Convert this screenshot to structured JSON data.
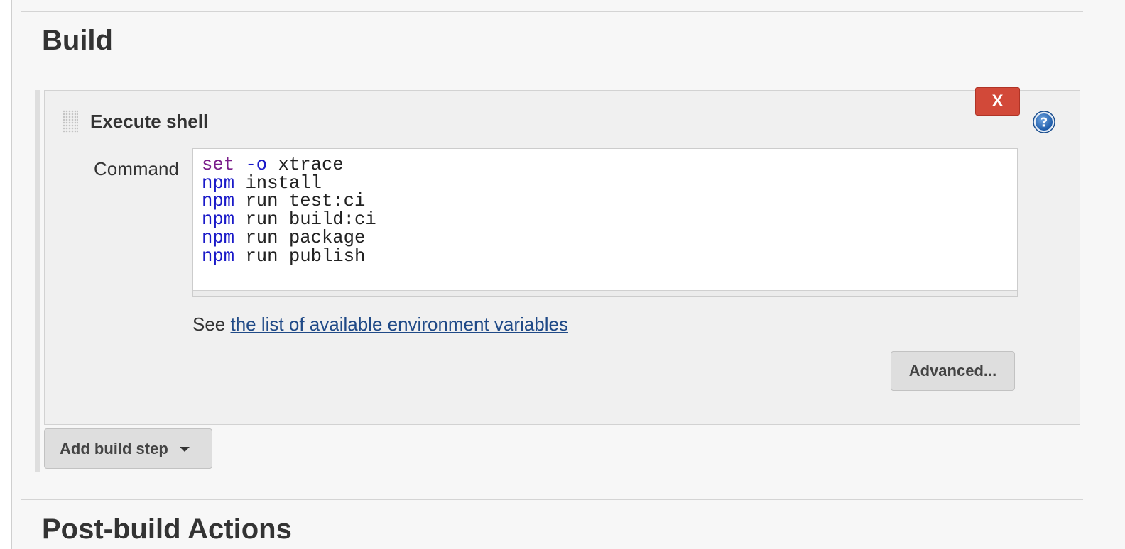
{
  "sections": {
    "build_title": "Build",
    "post_build_title": "Post-build Actions"
  },
  "step": {
    "title": "Execute shell",
    "delete_label": "X",
    "help_icon": "help-circle-icon",
    "command_label": "Command",
    "command_lines": [
      {
        "keyword": "set",
        "flag": "-o",
        "rest": "xtrace"
      },
      {
        "keyword": "",
        "flag": "npm",
        "rest": "install"
      },
      {
        "keyword": "",
        "flag": "npm",
        "rest": "run test:ci"
      },
      {
        "keyword": "",
        "flag": "npm",
        "rest": "run build:ci"
      },
      {
        "keyword": "",
        "flag": "npm",
        "rest": "run package"
      },
      {
        "keyword": "",
        "flag": "npm",
        "rest": "run publish"
      }
    ],
    "env_note_prefix": "See",
    "env_link_text": "the list of available environment variables",
    "advanced_label": "Advanced..."
  },
  "add_step": {
    "label": "Add build step",
    "caret_icon": "caret-down-icon"
  },
  "colors": {
    "delete_button": "#d24939",
    "link": "#204a87",
    "shell_keyword": "#7a1d8a",
    "shell_command": "#1a1ac8"
  }
}
